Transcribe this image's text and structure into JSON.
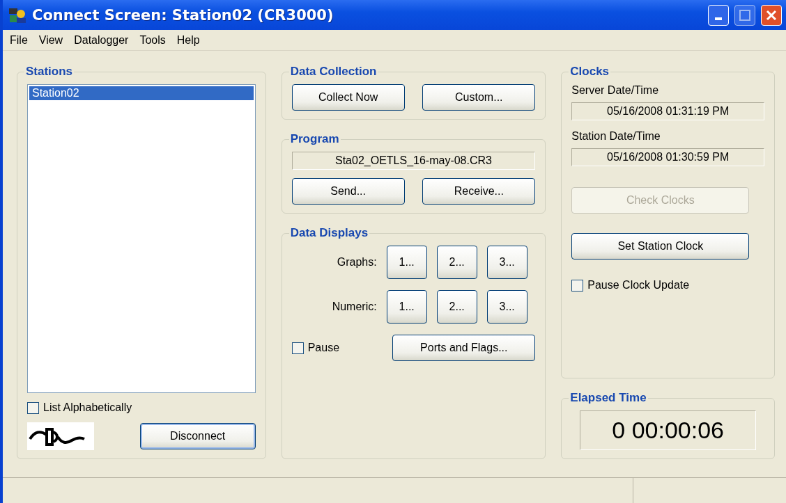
{
  "window": {
    "title": "Connect Screen: Station02 (CR3000)"
  },
  "menu": [
    "File",
    "View",
    "Datalogger",
    "Tools",
    "Help"
  ],
  "stations": {
    "title": "Stations",
    "items": [
      {
        "label": "Station02",
        "selected": true
      }
    ],
    "list_alphabetically": {
      "label": "List Alphabetically",
      "checked": false
    },
    "disconnect_button": "Disconnect"
  },
  "data_collection": {
    "title": "Data Collection",
    "buttons": [
      "Collect Now",
      "Custom..."
    ]
  },
  "program": {
    "title": "Program",
    "file": "Sta02_OETLS_16-may-08.CR3",
    "buttons": [
      "Send...",
      "Receive..."
    ]
  },
  "data_displays": {
    "title": "Data Displays",
    "rows": [
      {
        "label": "Graphs:",
        "buttons": [
          "1...",
          "2...",
          "3..."
        ]
      },
      {
        "label": "Numeric:",
        "buttons": [
          "1...",
          "2...",
          "3..."
        ]
      }
    ],
    "pause": {
      "label": "Pause",
      "checked": false
    },
    "ports_button": "Ports and Flags..."
  },
  "clocks": {
    "title": "Clocks",
    "fields": [
      {
        "label": "Server Date/Time",
        "value": "05/16/2008 01:31:19 PM"
      },
      {
        "label": "Station Date/Time",
        "value": "05/16/2008 01:30:59 PM"
      }
    ],
    "buttons": [
      {
        "label": "Check Clocks",
        "disabled": true
      },
      {
        "label": "Set Station Clock",
        "disabled": false
      }
    ],
    "pause_clock_update": {
      "label": "Pause Clock Update",
      "checked": false
    }
  },
  "elapsed_time": {
    "title": "Elapsed Time",
    "value": "0 00:00:06"
  }
}
